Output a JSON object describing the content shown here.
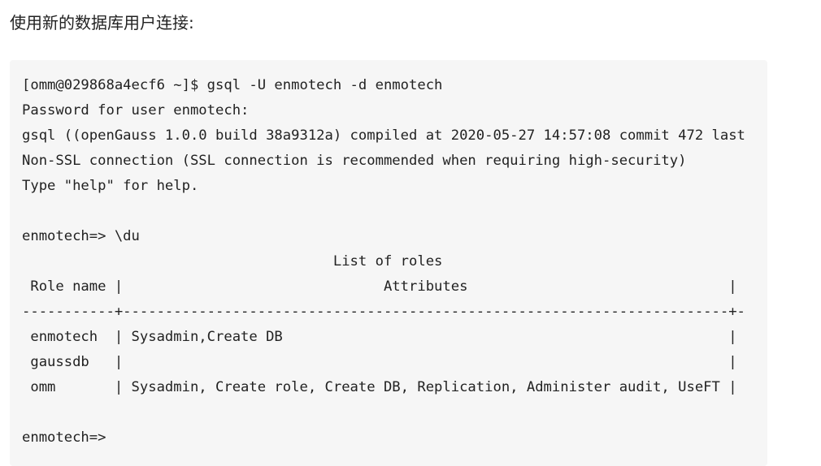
{
  "heading": "使用新的数据库用户连接:",
  "terminal_lines": [
    "[omm@029868a4ecf6 ~]$ gsql -U enmotech -d enmotech",
    "Password for user enmotech:",
    "gsql ((openGauss 1.0.0 build 38a9312a) compiled at 2020-05-27 14:57:08 commit 472 last",
    "Non-SSL connection (SSL connection is recommended when requiring high-security)",
    "Type \"help\" for help.",
    "",
    "enmotech=> \\du",
    "                                     List of roles",
    " Role name |                               Attributes                               |",
    "-----------+------------------------------------------------------------------------+-",
    " enmotech  | Sysadmin,Create DB                                                     |",
    " gaussdb   |                                                                        |",
    " omm       | Sysadmin, Create role, Create DB, Replication, Administer audit, UseFT |",
    "",
    "enmotech=>"
  ]
}
